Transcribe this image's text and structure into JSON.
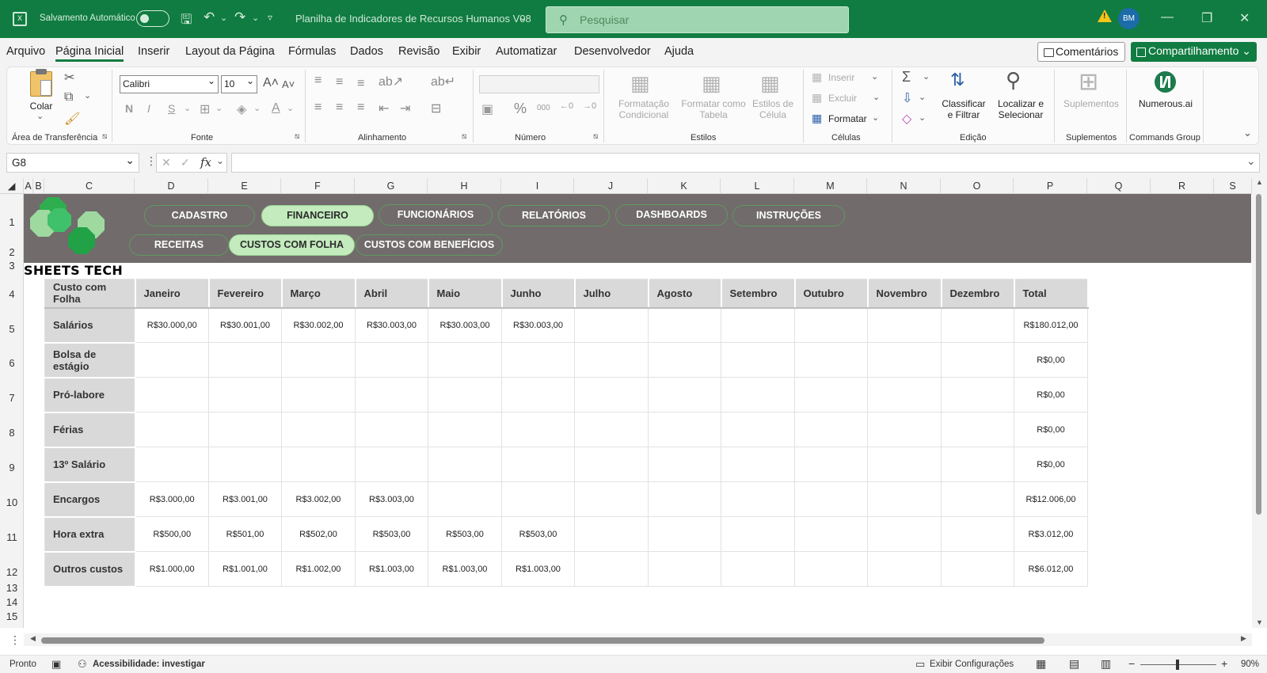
{
  "titlebar": {
    "autosave_label": "Salvamento Automático",
    "document_title": "Planilha de Indicadores de Recursos Humanos V08",
    "search_placeholder": "Pesquisar",
    "avatar_initials": "BM"
  },
  "menu": {
    "items": [
      "Arquivo",
      "Página Inicial",
      "Inserir",
      "Layout da Página",
      "Fórmulas",
      "Dados",
      "Revisão",
      "Exibir",
      "Automatizar",
      "Desenvolvedor",
      "Ajuda"
    ],
    "active": "Página Inicial",
    "comments_label": "Comentários",
    "share_label": "Compartilhamento"
  },
  "ribbon": {
    "clipboard": {
      "paste_label": "Colar",
      "group_label": "Área de Transferência"
    },
    "font": {
      "font_name": "Calibri",
      "font_size": "10",
      "group_label": "Fonte",
      "bold": "N",
      "italic": "I",
      "underline": "S"
    },
    "alignment": {
      "group_label": "Alinhamento"
    },
    "number": {
      "group_label": "Número"
    },
    "styles": {
      "conditional_label": "Formatação Condicional",
      "table_label": "Formatar como Tabela",
      "cell_styles_label": "Estilos de Célula",
      "group_label": "Estilos"
    },
    "cells": {
      "insert_label": "Inserir",
      "delete_label": "Excluir",
      "format_label": "Formatar",
      "group_label": "Células"
    },
    "editing": {
      "sort_label": "Classificar e Filtrar",
      "find_label": "Localizar e Selecionar",
      "group_label": "Edição"
    },
    "addins": {
      "addins_label": "Suplementos",
      "group_label": "Suplementos"
    },
    "commands": {
      "numerous_label": "Numerous.ai",
      "group_label": "Commands Group"
    }
  },
  "formula_bar": {
    "name_box": "G8",
    "fx": "fx",
    "formula": ""
  },
  "columns": [
    "A",
    "B",
    "C",
    "D",
    "E",
    "F",
    "G",
    "H",
    "I",
    "J",
    "K",
    "L",
    "M",
    "N",
    "O",
    "P",
    "Q",
    "R",
    "S"
  ],
  "rows": [
    "1",
    "2",
    "3",
    "4",
    "5",
    "6",
    "7",
    "8",
    "9",
    "10",
    "11",
    "12",
    "13",
    "14",
    "15"
  ],
  "sheet": {
    "brand": "SHEETS TECH",
    "nav_main": [
      "CADASTRO",
      "FINANCEIRO",
      "FUNCIONÁRIOS",
      "RELATÓRIOS",
      "DASHBOARDS",
      "INSTRUÇÕES"
    ],
    "nav_main_active": "FINANCEIRO",
    "nav_sub": [
      "RECEITAS",
      "CUSTOS COM FOLHA",
      "CUSTOS COM BENEFÍCIOS"
    ],
    "nav_sub_active": "CUSTOS COM FOLHA",
    "table": {
      "headers": [
        "Custo com Folha",
        "Janeiro",
        "Fevereiro",
        "Março",
        "Abril",
        "Maio",
        "Junho",
        "Julho",
        "Agosto",
        "Setembro",
        "Outubro",
        "Novembro",
        "Dezembro",
        "Total"
      ],
      "rows": [
        {
          "label": "Salários",
          "values": [
            "R$30.000,00",
            "R$30.001,00",
            "R$30.002,00",
            "R$30.003,00",
            "R$30.003,00",
            "R$30.003,00",
            "",
            "",
            "",
            "",
            "",
            ""
          ],
          "total": "R$180.012,00"
        },
        {
          "label": "Bolsa de estágio",
          "values": [
            "",
            "",
            "",
            "",
            "",
            "",
            "",
            "",
            "",
            "",
            "",
            ""
          ],
          "total": "R$0,00"
        },
        {
          "label": "Pró-labore",
          "values": [
            "",
            "",
            "",
            "",
            "",
            "",
            "",
            "",
            "",
            "",
            "",
            ""
          ],
          "total": "R$0,00"
        },
        {
          "label": "Férias",
          "values": [
            "",
            "",
            "",
            "",
            "",
            "",
            "",
            "",
            "",
            "",
            "",
            ""
          ],
          "total": "R$0,00"
        },
        {
          "label": "13º Salário",
          "values": [
            "",
            "",
            "",
            "",
            "",
            "",
            "",
            "",
            "",
            "",
            "",
            ""
          ],
          "total": "R$0,00"
        },
        {
          "label": "Encargos",
          "values": [
            "R$3.000,00",
            "R$3.001,00",
            "R$3.002,00",
            "R$3.003,00",
            "",
            "",
            "",
            "",
            "",
            "",
            "",
            ""
          ],
          "total": "R$12.006,00"
        },
        {
          "label": "Hora extra",
          "values": [
            "R$500,00",
            "R$501,00",
            "R$502,00",
            "R$503,00",
            "R$503,00",
            "R$503,00",
            "",
            "",
            "",
            "",
            "",
            ""
          ],
          "total": "R$3.012,00"
        },
        {
          "label": "Outros custos",
          "values": [
            "R$1.000,00",
            "R$1.001,00",
            "R$1.002,00",
            "R$1.003,00",
            "R$1.003,00",
            "R$1.003,00",
            "",
            "",
            "",
            "",
            "",
            ""
          ],
          "total": "R$6.012,00"
        }
      ]
    }
  },
  "statusbar": {
    "ready": "Pronto",
    "accessibility": "Acessibilidade: investigar",
    "display_settings": "Exibir Configurações",
    "zoom": "90%"
  },
  "colors": {
    "excel_green": "#107c41",
    "banner_gray": "#716b6b",
    "pill_active": "#c3ebbd",
    "header_gray": "#d9d9d9"
  }
}
